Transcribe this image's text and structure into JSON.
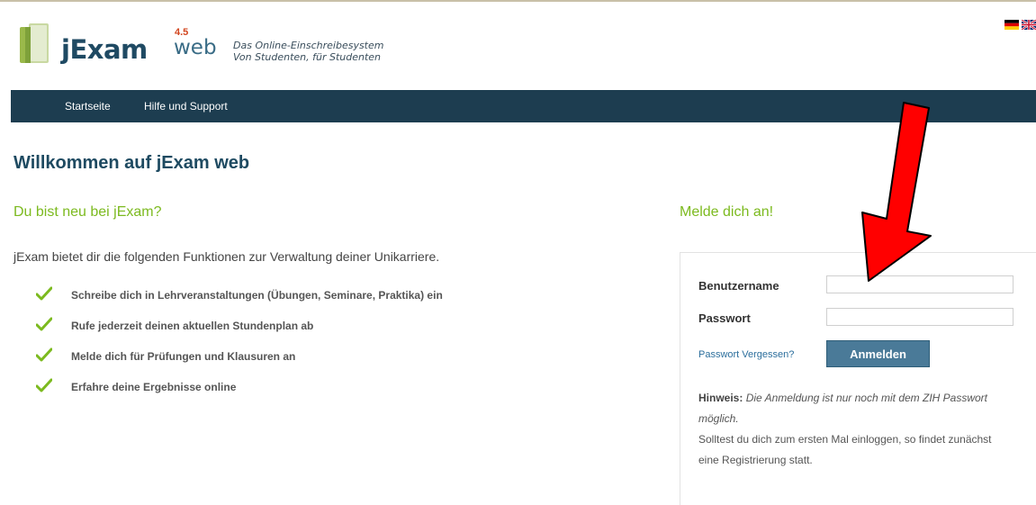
{
  "header": {
    "logo": {
      "name": "jExam",
      "version": "4.5",
      "suffix": "web"
    },
    "tagline_line1": "Das Online-Einschreibesystem",
    "tagline_line2": "Von Studenten, für Studenten"
  },
  "nav": {
    "items": [
      "Startseite",
      "Hilfe und Support"
    ]
  },
  "main": {
    "page_title": "Willkommen auf jExam web",
    "intro_heading": "Du bist neu bei jExam?",
    "intro_text": "jExam bietet dir die folgenden Funktionen zur Verwaltung deiner Unikarriere.",
    "features": [
      "Schreibe dich in Lehrveranstaltungen (Übungen, Seminare, Praktika) ein",
      "Rufe jederzeit deinen aktuellen Stundenplan ab",
      "Melde dich für Prüfungen und Klausuren an",
      "Erfahre deine Ergebnisse online"
    ]
  },
  "login": {
    "heading": "Melde dich an!",
    "username_label": "Benutzername",
    "username_value": "",
    "password_label": "Passwort",
    "password_value": "",
    "forgot_link": "Passwort Vergessen?",
    "submit_label": "Anmelden",
    "hint_label": "Hinweis:",
    "hint_italic": "Die Anmeldung ist nur noch mit dem ZIH Passwort möglich.",
    "hint_text": "Solltest du dich zum ersten Mal einloggen, so findet zunächst eine Registrierung statt."
  },
  "colors": {
    "nav_bg": "#1d3d50",
    "accent_green": "#7cba1f",
    "title_blue": "#1e4a61",
    "button_blue": "#4a7a98",
    "annotation_arrow": "#ff0000"
  },
  "icons": [
    "book-logo-icon",
    "german-flag-icon",
    "uk-flag-icon",
    "checkmark-icon",
    "red-arrow-annotation"
  ]
}
